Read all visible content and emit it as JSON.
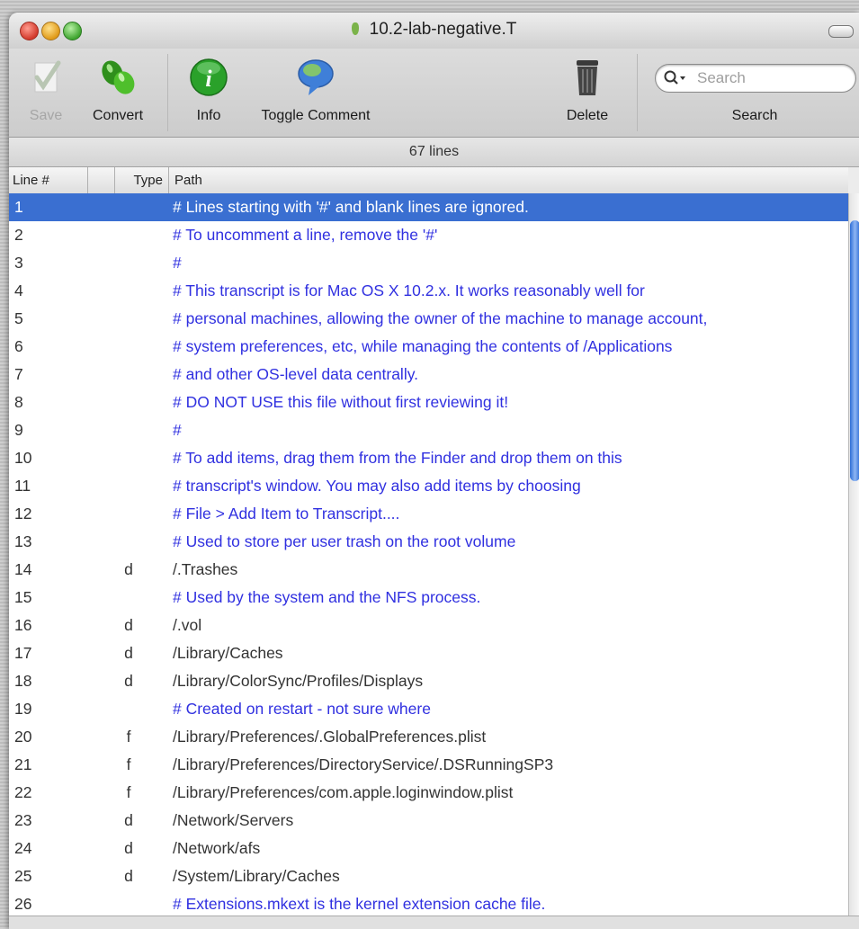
{
  "window": {
    "title": "10.2-lab-negative.T"
  },
  "toolbar": {
    "items": [
      {
        "name": "save",
        "label": "Save",
        "icon": "checkmark-icon",
        "enabled": false
      },
      {
        "name": "convert",
        "label": "Convert",
        "icon": "green-pills-icon",
        "enabled": true
      },
      {
        "name": "info",
        "label": "Info",
        "icon": "info-icon",
        "enabled": true
      },
      {
        "name": "toggle_comment",
        "label": "Toggle Comment",
        "icon": "speech-bubble-icon",
        "enabled": true
      },
      {
        "name": "delete",
        "label": "Delete",
        "icon": "trash-can-icon",
        "enabled": true
      }
    ],
    "search": {
      "placeholder": "Search",
      "label": "Search"
    }
  },
  "status": {
    "line_count": "67 lines"
  },
  "table": {
    "columns": [
      "Line #",
      "Type",
      "Path"
    ],
    "selected_row": 1,
    "rows": [
      {
        "line": "1",
        "type": "",
        "path": "# Lines starting with '#' and blank lines are ignored.",
        "comment": true
      },
      {
        "line": "2",
        "type": "",
        "path": "# To uncomment a line, remove the '#'",
        "comment": true
      },
      {
        "line": "3",
        "type": "",
        "path": "#",
        "comment": true
      },
      {
        "line": "4",
        "type": "",
        "path": "# This transcript is for Mac OS X 10.2.x.  It works reasonably well for",
        "comment": true
      },
      {
        "line": "5",
        "type": "",
        "path": "# personal machines, allowing the owner of the machine to manage account,",
        "comment": true
      },
      {
        "line": "6",
        "type": "",
        "path": "# system preferences, etc, while managing the contents of /Applications",
        "comment": true
      },
      {
        "line": "7",
        "type": "",
        "path": "# and other OS-level data centrally.",
        "comment": true
      },
      {
        "line": "8",
        "type": "",
        "path": "# DO NOT USE this file without first reviewing it!",
        "comment": true
      },
      {
        "line": "9",
        "type": "",
        "path": "#",
        "comment": true
      },
      {
        "line": "10",
        "type": "",
        "path": "# To add items, drag them from the Finder and drop them on this",
        "comment": true
      },
      {
        "line": "11",
        "type": "",
        "path": "# transcript's window. You may also add items by choosing",
        "comment": true
      },
      {
        "line": "12",
        "type": "",
        "path": "# File > Add Item to Transcript....",
        "comment": true
      },
      {
        "line": "13",
        "type": "",
        "path": "# Used to store per user trash on the root volume",
        "comment": true
      },
      {
        "line": "14",
        "type": "d",
        "path": "/.Trashes",
        "comment": false
      },
      {
        "line": "15",
        "type": "",
        "path": "# Used by the system and the NFS process.",
        "comment": true
      },
      {
        "line": "16",
        "type": "d",
        "path": "/.vol",
        "comment": false
      },
      {
        "line": "17",
        "type": "d",
        "path": "/Library/Caches",
        "comment": false
      },
      {
        "line": "18",
        "type": "d",
        "path": "/Library/ColorSync/Profiles/Displays",
        "comment": false
      },
      {
        "line": "19",
        "type": "",
        "path": "# Created on restart - not sure where",
        "comment": true
      },
      {
        "line": "20",
        "type": "f",
        "path": "/Library/Preferences/.GlobalPreferences.plist",
        "comment": false
      },
      {
        "line": "21",
        "type": "f",
        "path": "/Library/Preferences/DirectoryService/.DSRunningSP3",
        "comment": false
      },
      {
        "line": "22",
        "type": "f",
        "path": "/Library/Preferences/com.apple.loginwindow.plist",
        "comment": false
      },
      {
        "line": "23",
        "type": "d",
        "path": "/Network/Servers",
        "comment": false
      },
      {
        "line": "24",
        "type": "d",
        "path": "/Network/afs",
        "comment": false
      },
      {
        "line": "25",
        "type": "d",
        "path": "/System/Library/Caches",
        "comment": false
      },
      {
        "line": "26",
        "type": "",
        "path": "# Extensions.mkext is the kernel extension cache file.",
        "comment": true
      }
    ]
  },
  "colors": {
    "selection": "#3a6fd1",
    "comment_text": "#3030e0",
    "path_text": "#333333"
  }
}
